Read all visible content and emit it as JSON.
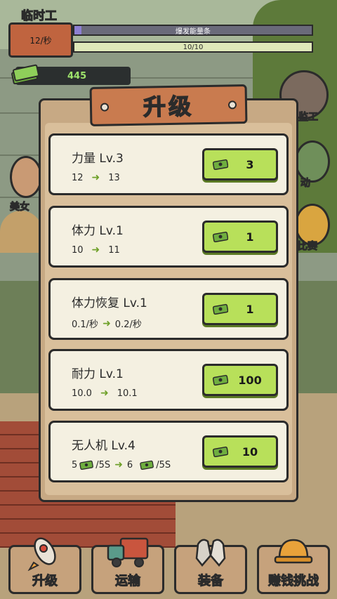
{
  "hud": {
    "role_title": "临时工",
    "speed": "12/秒",
    "power_bar_label": "爆发能量条",
    "stamina_bar": "10/10",
    "cash": "445"
  },
  "side": {
    "supervisor": "监工",
    "beauty": "美女",
    "move": "动",
    "contest": "比赛"
  },
  "modal": {
    "title": "升级",
    "upgrades": [
      {
        "name": "力量 Lv.3",
        "from": "12",
        "to": "13",
        "cost": "3"
      },
      {
        "name": "体力 Lv.1",
        "from": "10",
        "to": "11",
        "cost": "1"
      },
      {
        "name": "体力恢复 Lv.1",
        "from": "0.1/秒",
        "to": "0.2/秒",
        "cost": "1"
      },
      {
        "name": "耐力 Lv.1",
        "from": "10.0",
        "to": "10.1",
        "cost": "100"
      },
      {
        "name": "无人机 Lv.4",
        "from": "5",
        "from_unit": "/5S",
        "to": "6",
        "to_unit": "/5S",
        "cost": "10"
      }
    ]
  },
  "nav": {
    "upgrade": "升级",
    "transport": "运输",
    "equip": "装备",
    "challenge": "赚钱挑战"
  },
  "colors": {
    "buy_button": "#b8e05a",
    "card_bg": "#f4f0e1",
    "plank": "#c97b4f",
    "arrow": "#6fa12a"
  }
}
